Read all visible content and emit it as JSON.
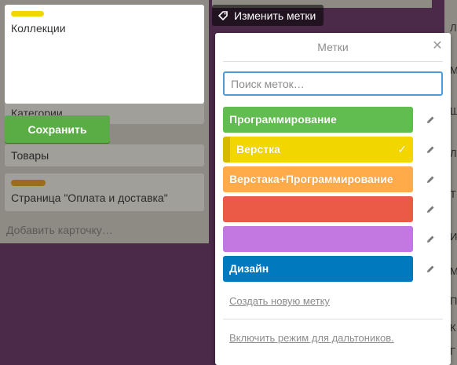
{
  "list": {
    "cards": [
      {
        "text": "Категории",
        "label_color": "#c9b55a"
      },
      {
        "text": "Товары",
        "label_color": ""
      },
      {
        "text": "Страница \"Оплата и доставка\"",
        "label_color": "#9a6c1e"
      }
    ],
    "add_card": "Добавить карточку…"
  },
  "editing_card": {
    "text": "Коллекции",
    "label_color": "#f2d600",
    "save_label": "Сохранить"
  },
  "edit_labels_button": {
    "label": "Изменить метки",
    "icon": "tag-icon"
  },
  "popover": {
    "title": "Метки",
    "close_icon": "close-icon",
    "search_placeholder": "Поиск меток…",
    "labels": [
      {
        "name": "Программирование",
        "color": "#61bd4f",
        "selected": false
      },
      {
        "name": "Верстка",
        "color": "#f2d600",
        "selected": true
      },
      {
        "name": "Верстака+Программирование",
        "color": "#ffab4a",
        "selected": false
      },
      {
        "name": "",
        "color": "#eb5a46",
        "selected": false
      },
      {
        "name": "",
        "color": "#c377e0",
        "selected": false
      },
      {
        "name": "Дизайн",
        "color": "#0079bf",
        "selected": false
      }
    ],
    "create_label_link": "Создать новую метку",
    "colorblind_link": "Включить режим для дальтоников."
  },
  "right_edge": {
    "fragments": [
      "Л",
      "М",
      "Ш",
      "Л",
      "Т",
      "И",
      "М",
      "П",
      "К",
      "Г"
    ]
  }
}
